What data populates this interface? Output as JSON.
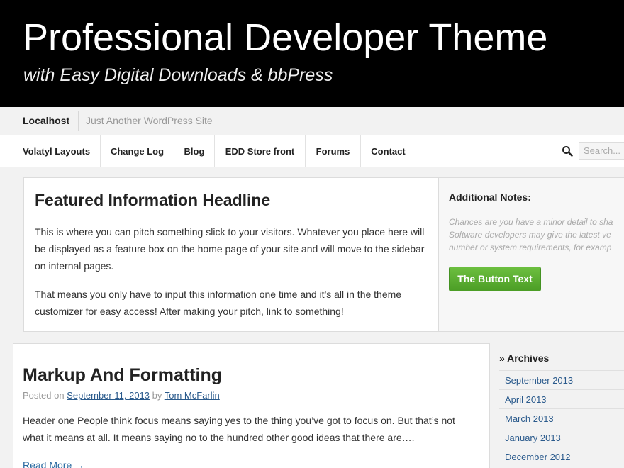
{
  "header": {
    "title": "Professional Developer Theme",
    "subtitle": "with Easy Digital Downloads & bbPress"
  },
  "site": {
    "name": "Localhost",
    "description": "Just Another WordPress Site"
  },
  "nav": {
    "items": [
      {
        "label": "Volatyl Layouts"
      },
      {
        "label": "Change Log"
      },
      {
        "label": "Blog"
      },
      {
        "label": "EDD Store front"
      },
      {
        "label": "Forums"
      },
      {
        "label": "Contact"
      }
    ],
    "search_placeholder": "Search..."
  },
  "featured": {
    "headline": "Featured Information Headline",
    "paragraph1": "This is where you can pitch something slick to your visitors. Whatever you place here will be displayed as a feature box on the home page of your site and will move to the sidebar on internal pages.",
    "paragraph2": "That means you only have to input this information one time and it's all in the theme customizer for easy access! After making your pitch, link to something!"
  },
  "notes": {
    "heading": "Additional Notes:",
    "text": "Chances are you have a minor detail to sha\nSoftware developers may give the latest ve\nnumber or system requirements, for examp",
    "button_label": "The Button Text"
  },
  "post": {
    "title": "Markup And Formatting",
    "posted_on": "Posted on",
    "date": "September 11, 2013",
    "by": "by",
    "author": "Tom McFarlin",
    "excerpt": "Header one People think focus means saying yes to the thing you’ve got to focus on. But that’s not what it means at all. It means saying no to the hundred other good ideas that there are….",
    "read_more": "Read More →"
  },
  "archives": {
    "heading": "» Archives",
    "items": [
      {
        "label": "September 2013"
      },
      {
        "label": "April 2013"
      },
      {
        "label": "March 2013"
      },
      {
        "label": "January 2013"
      },
      {
        "label": "December 2012"
      }
    ]
  },
  "icons": {
    "search": "search-icon"
  },
  "colors": {
    "banner_bg": "#000000",
    "button_green": "#5aaf30",
    "link": "#2a5a8c"
  }
}
